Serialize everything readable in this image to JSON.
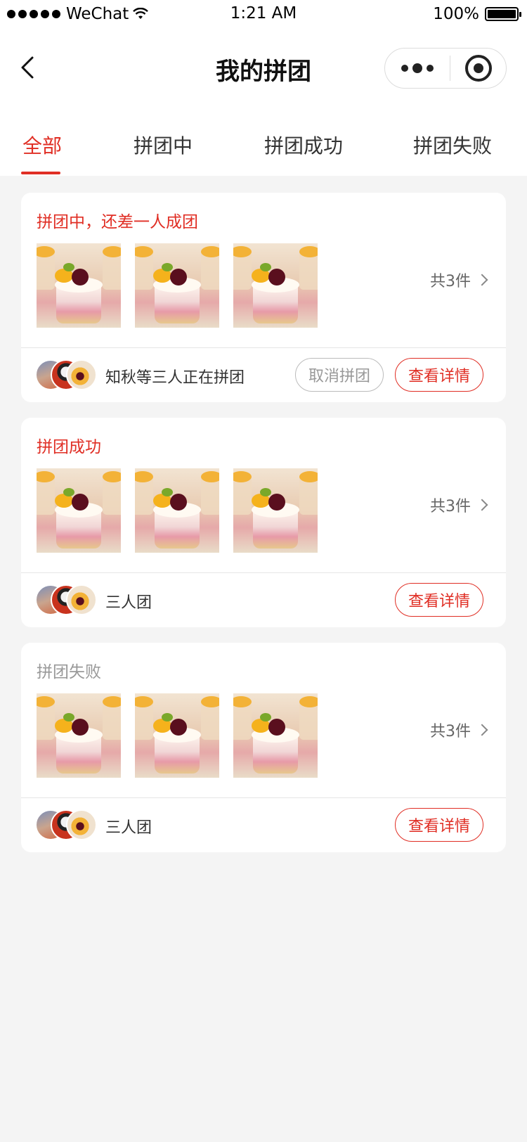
{
  "status_bar": {
    "carrier": "WeChat",
    "time": "1:21 AM",
    "battery": "100%"
  },
  "nav": {
    "title": "我的拼团",
    "back_icon": "chevron-left-icon",
    "more_icon": "more-dots-icon",
    "close_icon": "target-close-icon"
  },
  "tabs": [
    {
      "label": "全部",
      "active": true
    },
    {
      "label": "拼团中",
      "active": false
    },
    {
      "label": "拼团成功",
      "active": false
    },
    {
      "label": "拼团失败",
      "active": false
    }
  ],
  "orders": [
    {
      "status": "拼团中，还差一人成团",
      "status_color": "#e02e24",
      "count": "共3件",
      "group_text": "知秋等三人正在拼团",
      "cancel_label": "取消拼团",
      "detail_label": "查看详情"
    },
    {
      "status": "拼团成功",
      "status_color": "#e02e24",
      "count": "共3件",
      "group_text": "三人团",
      "detail_label": "查看详情"
    },
    {
      "status": "拼团失败",
      "status_color": "#999999",
      "count": "共3件",
      "group_text": "三人团",
      "detail_label": "查看详情"
    }
  ],
  "colors": {
    "accent": "#e02e24",
    "background": "#f4f4f4",
    "muted": "#999999"
  }
}
